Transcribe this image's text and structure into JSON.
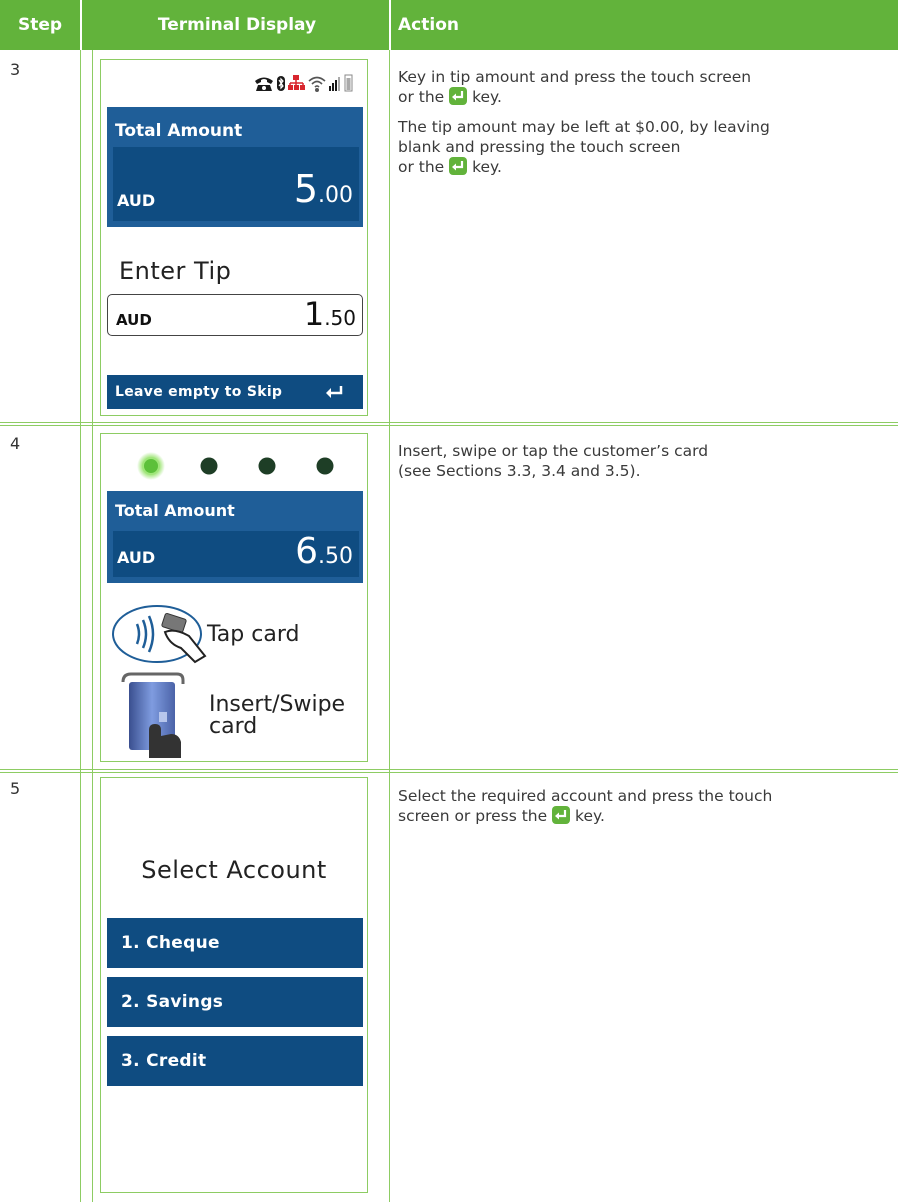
{
  "table": {
    "headers": {
      "step": "Step",
      "terminal": "Terminal Display",
      "action": "Action"
    },
    "rows": [
      {
        "step": "3",
        "action_paragraphs": [
          [
            "Key in tip amount and press the touch screen",
            "or the ",
            " key."
          ],
          [
            "The tip amount may be left at $0.00, by leaving",
            "blank and pressing the touch screen",
            "or the ",
            " key."
          ]
        ],
        "terminal": {
          "total_label": "Total Amount",
          "currency": "AUD",
          "total_int": "5",
          "total_dec": ".00",
          "prompt": "Enter Tip",
          "tip_currency": "AUD",
          "tip_int": "1",
          "tip_dec": ".50",
          "skip_button": "Leave empty to Skip"
        }
      },
      {
        "step": "4",
        "action_paragraphs": [
          [
            "Insert, swipe or tap the customer’s card",
            "(see Sections 3.3, 3.4 and 3.5)."
          ]
        ],
        "terminal": {
          "total_label": "Total Amount",
          "currency": "AUD",
          "total_int": "6",
          "total_dec": ".50",
          "tap_label": "Tap card",
          "insert_label_1": "Insert/Swipe",
          "insert_label_2": "card"
        }
      },
      {
        "step": "5",
        "action_paragraphs": [
          [
            "Select the required account and press the touch",
            "screen or press the ",
            " key."
          ]
        ],
        "terminal": {
          "title": "Select Account",
          "options": [
            "1. Cheque",
            "2. Savings",
            "3. Credit"
          ]
        }
      }
    ]
  },
  "colors": {
    "header_green": "#62b33b",
    "border_green": "#8dcc63",
    "terminal_blue": "#0f4c81",
    "terminal_blue_light": "#1f5e98",
    "led_green": "#7fdc4a",
    "led_dark": "#1e3e26"
  },
  "icons": [
    "telephone-icon",
    "bluetooth-icon",
    "network-icon",
    "wifi-icon",
    "signal-icon",
    "battery-icon",
    "enter-key-icon",
    "contactless-icon",
    "card-insert-icon"
  ]
}
